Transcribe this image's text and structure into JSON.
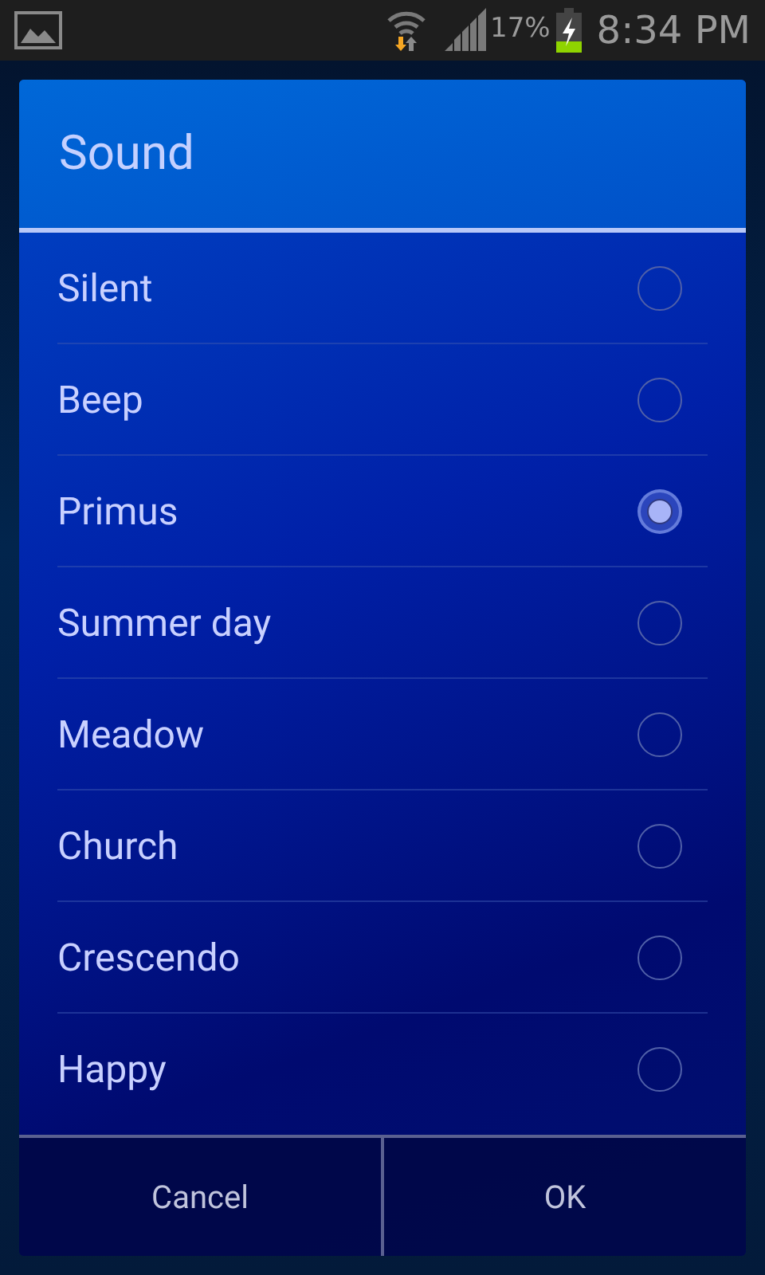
{
  "status_bar": {
    "battery": "17%",
    "time": "8:34 PM"
  },
  "dialog": {
    "title": "Sound",
    "options": [
      {
        "label": "Silent",
        "selected": false
      },
      {
        "label": "Beep",
        "selected": false
      },
      {
        "label": "Primus",
        "selected": true
      },
      {
        "label": "Summer day",
        "selected": false
      },
      {
        "label": "Meadow",
        "selected": false
      },
      {
        "label": "Church",
        "selected": false
      },
      {
        "label": "Crescendo",
        "selected": false
      },
      {
        "label": "Happy",
        "selected": false
      }
    ],
    "buttons": [
      "Cancel",
      "OK"
    ]
  }
}
